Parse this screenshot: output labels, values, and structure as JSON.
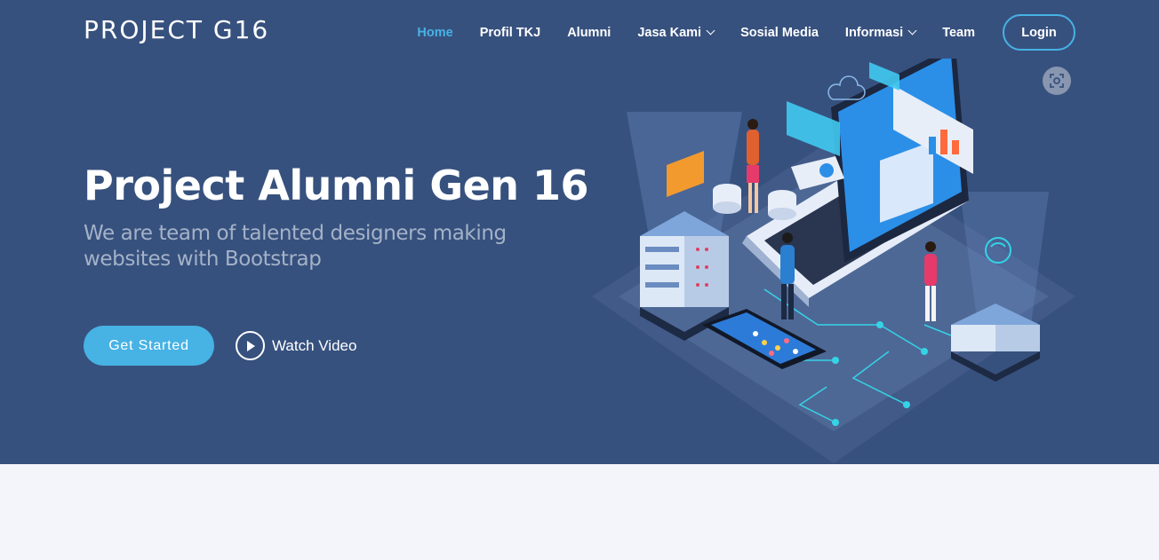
{
  "brand": {
    "logo": "PROJECT G16"
  },
  "nav": {
    "items": [
      {
        "label": "Home",
        "active": true,
        "dropdown": false
      },
      {
        "label": "Profil TKJ",
        "active": false,
        "dropdown": false
      },
      {
        "label": "Alumni",
        "active": false,
        "dropdown": false
      },
      {
        "label": "Jasa Kami",
        "active": false,
        "dropdown": true
      },
      {
        "label": "Sosial Media",
        "active": false,
        "dropdown": false
      },
      {
        "label": "Informasi",
        "active": false,
        "dropdown": true
      },
      {
        "label": "Team",
        "active": false,
        "dropdown": false
      }
    ],
    "login_label": "Login"
  },
  "hero": {
    "title": "Project Alumni Gen 16",
    "subtitle": "We are team of talented designers making websites with Bootstrap",
    "cta_label": "Get Started",
    "video_label": "Watch Video"
  },
  "colors": {
    "hero_bg": "#37517e",
    "accent": "#47b2e4",
    "page_bg": "#f3f5fa",
    "subtitle": "#a4b2c8"
  },
  "icons": {
    "scan": "screen-capture-icon",
    "play": "play-icon",
    "dropdown": "chevron-down-icon"
  }
}
